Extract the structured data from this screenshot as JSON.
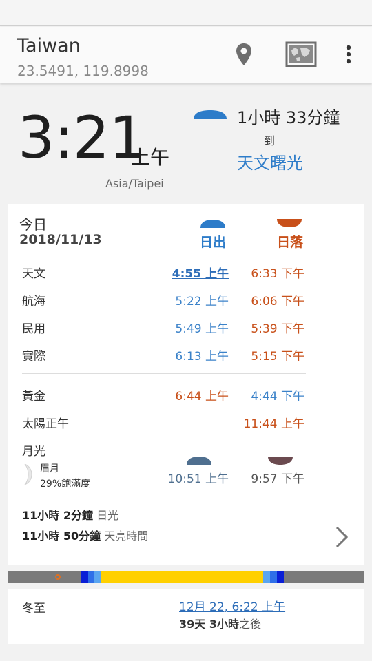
{
  "location": {
    "name": "Taiwan",
    "coordinates": "23.5491, 119.8998"
  },
  "toolbar_icons": [
    "location-pin-icon",
    "map-icon",
    "more-vert-icon"
  ],
  "now": {
    "time": "3:21",
    "ampm": "上午",
    "timezone": "Asia/Taipei",
    "countdown": "1小時 33分鐘",
    "to_label": "到",
    "next_event": "天文曙光"
  },
  "today": {
    "label": "今日",
    "date": "2018/11/13",
    "sunrise_header": "日出",
    "sunset_header": "日落",
    "twilight_rows": [
      {
        "label": "天文",
        "rise": "4:55 上午",
        "set": "6:33 下午"
      },
      {
        "label": "航海",
        "rise": "5:22 上午",
        "set": "6:06 下午"
      },
      {
        "label": "民用",
        "rise": "5:49 上午",
        "set": "5:39 下午"
      },
      {
        "label": "實際",
        "rise": "6:13 上午",
        "set": "5:15 下午"
      }
    ],
    "golden": {
      "label": "黃金",
      "morning": "6:44 上午",
      "evening": "4:44 下午"
    },
    "noon": {
      "label": "太陽正午",
      "value": "11:44 上午"
    },
    "moon": {
      "label": "月光",
      "phase_name": "眉月",
      "illumination": "29%飽滿度",
      "rise": "10:51 上午",
      "set": "9:57 下午"
    },
    "day_length": {
      "value": "11小時 2分鐘",
      "label": "日光"
    },
    "light_length": {
      "value": "11小時 50分鐘",
      "label": "天亮時間"
    }
  },
  "timeline": {
    "colors": {
      "night": "#7a7a7a",
      "astronomical": "#0a1fd6",
      "nautical": "#2f6fe8",
      "civil": "#5aa5f0",
      "day": "#ffd000",
      "now_marker": "#e07020"
    }
  },
  "next_season": {
    "label": "冬至",
    "date": "12月 22, 6:22 上午",
    "remaining": "39天 3小時",
    "suffix": "之後"
  },
  "colors": {
    "rise_blue": "#2d7cc9",
    "set_orange": "#c8501a",
    "moonrise": "#4f6f8f",
    "moonset": "#6b4a4f"
  }
}
